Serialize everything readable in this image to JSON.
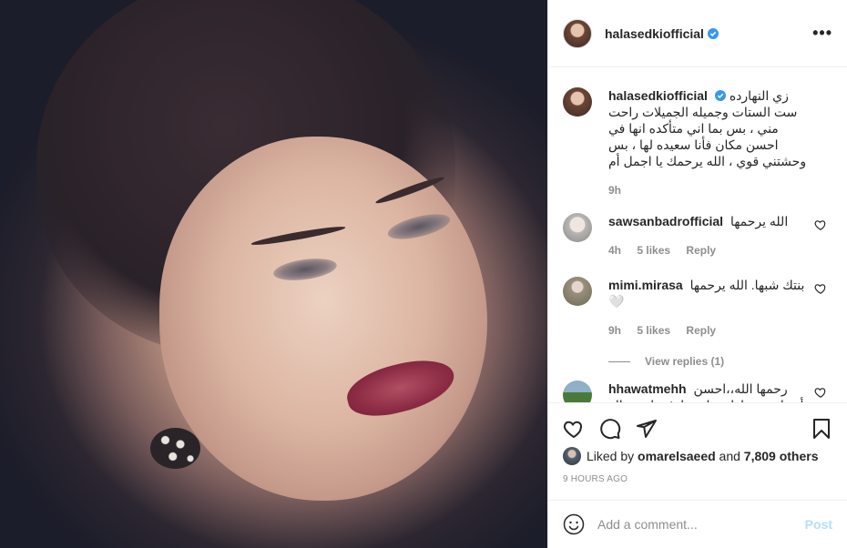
{
  "post": {
    "username": "halasedkiofficial",
    "verified": true,
    "caption": "زي النهارده ست الستات وجميله الجميلات راحت مني ، بس بما اني متأكده انها في احسن مكان فأنا سعيده لها ، بس وحشتني قوي ، الله يرحمك يا اجمل أم",
    "caption_emoji": "",
    "caption_time": "9h"
  },
  "comments": [
    {
      "username": "sawsanbadrofficial",
      "text": "الله يرحمها",
      "time": "4h",
      "likes": "5 likes",
      "reply": "Reply"
    },
    {
      "username": "mimi.mirasa",
      "text": "بنتك شبها. الله يرحمها 🤍",
      "time": "9h",
      "likes": "5 likes",
      "reply": "Reply",
      "view_replies": "View replies (1)"
    },
    {
      "username": "hhawatmehh",
      "text": "رحمها الله،،احسن أم،،انجبت،،اطيب،ام،،واوفى ام،، حالة ... لقاء الله العبد ... على قلبها"
    }
  ],
  "likes": {
    "prefix": "Liked by",
    "user": "omarelsaeed",
    "middle": "and",
    "count": "7,809 others"
  },
  "timestamp": "9 HOURS AGO",
  "add_comment": {
    "placeholder": "Add a comment...",
    "post_label": "Post"
  },
  "icons": {
    "more": "more-options-icon",
    "heart": "heart-icon",
    "comment": "comment-icon",
    "share": "share-icon",
    "save": "bookmark-icon",
    "emoji": "emoji-icon",
    "verified": "verified-badge-icon"
  },
  "colors": {
    "verified": "#3897f0",
    "post_disabled": "#b2dffc",
    "meta": "#8e8e8e"
  }
}
